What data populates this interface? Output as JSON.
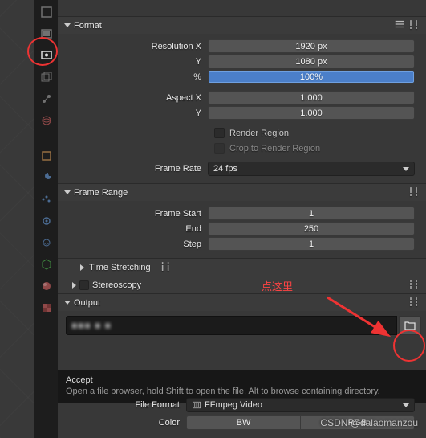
{
  "sections": {
    "format": {
      "title": "Format"
    },
    "frame_range": {
      "title": "Frame Range"
    },
    "time_stretching": {
      "title": "Time Stretching"
    },
    "stereoscopy": {
      "title": "Stereoscopy"
    },
    "output": {
      "title": "Output"
    }
  },
  "format": {
    "resolution_x_label": "Resolution X",
    "resolution_x": "1920 px",
    "resolution_y_label": "Y",
    "resolution_y": "1080 px",
    "percent_label": "%",
    "percent": "100%",
    "aspect_x_label": "Aspect X",
    "aspect_x": "1.000",
    "aspect_y_label": "Y",
    "aspect_y": "1.000",
    "render_region": "Render Region",
    "crop_to_region": "Crop to Render Region",
    "frame_rate_label": "Frame Rate",
    "frame_rate": "24 fps"
  },
  "frame_range": {
    "start_label": "Frame Start",
    "start": "1",
    "end_label": "End",
    "end": "250",
    "step_label": "Step",
    "step": "1"
  },
  "output": {
    "file_format_label": "File Format",
    "file_format": "FFmpeg Video",
    "color_label": "Color",
    "color_bw": "BW",
    "color_rgb": "RGB"
  },
  "tooltip": {
    "title": "Accept",
    "body": "Open a file browser, hold Shift to open the file, Alt to browse containing directory."
  },
  "annotations": {
    "click_here": "点这里"
  },
  "watermark": "CSDN @dalaomanzou"
}
